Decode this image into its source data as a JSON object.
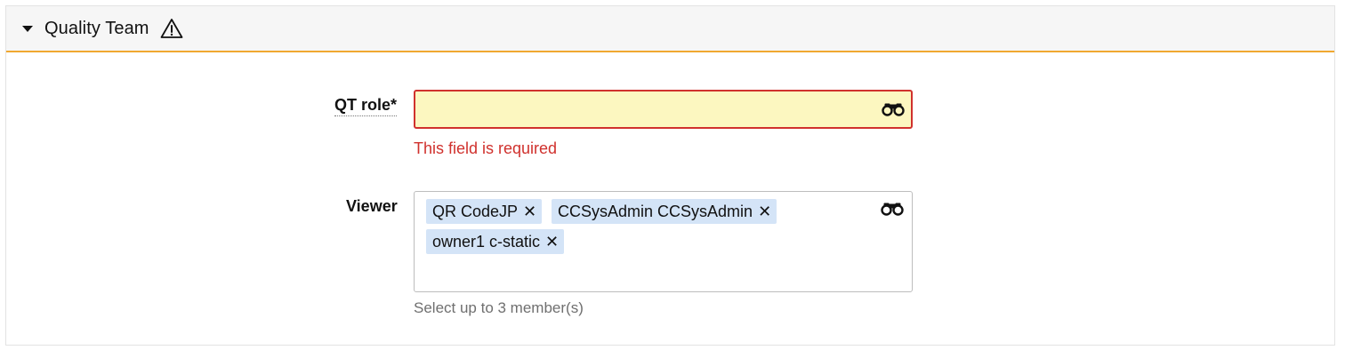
{
  "section": {
    "title": "Quality Team",
    "warning_icon": "warning-triangle-icon",
    "expanded_icon": "caret-down-icon",
    "accent_color": "#f0a830"
  },
  "fields": {
    "qt_role": {
      "label": "QT role*",
      "value": "",
      "search_icon": "binoculars-icon",
      "error": "This field is required",
      "error_color": "#d0312d",
      "background": "#fcf7c0"
    },
    "viewer": {
      "label": "Viewer",
      "search_icon": "binoculars-icon",
      "tags": [
        {
          "label": "QR CodeJP",
          "remove": "✕"
        },
        {
          "label": "CCSysAdmin CCSysAdmin",
          "remove": "✕"
        },
        {
          "label": "owner1 c-static",
          "remove": "✕"
        }
      ],
      "tag_color": "#d4e4f7",
      "help": "Select up to 3 member(s)"
    }
  }
}
